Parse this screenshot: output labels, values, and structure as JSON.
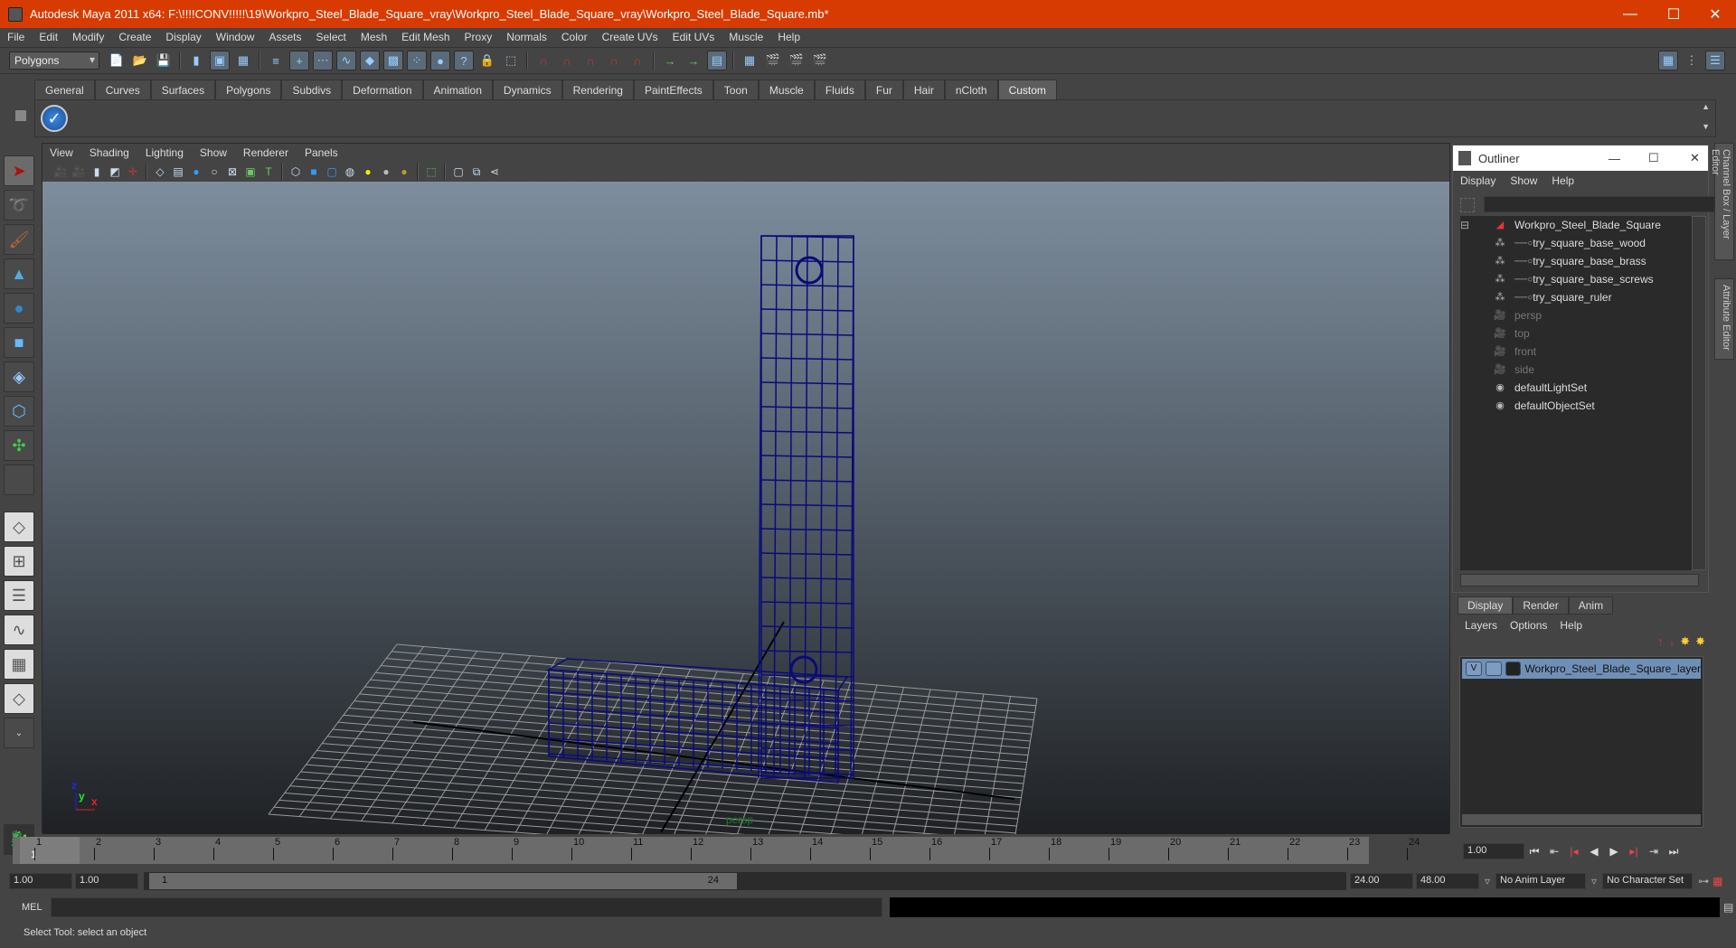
{
  "window": {
    "title": "Autodesk Maya 2011 x64: F:\\!!!!CONV!!!!!\\19\\Workpro_Steel_Blade_Square_vray\\Workpro_Steel_Blade_Square_vray\\Workpro_Steel_Blade_Square.mb*",
    "minimize": "—",
    "maximize": "☐",
    "close": "✕"
  },
  "menubar": [
    "File",
    "Edit",
    "Modify",
    "Create",
    "Display",
    "Window",
    "Assets",
    "Select",
    "Mesh",
    "Edit Mesh",
    "Proxy",
    "Normals",
    "Color",
    "Create UVs",
    "Edit UVs",
    "Muscle",
    "Help"
  ],
  "toolbar": {
    "mode": "Polygons"
  },
  "shelf": {
    "tabs": [
      "General",
      "Curves",
      "Surfaces",
      "Polygons",
      "Subdivs",
      "Deformation",
      "Animation",
      "Dynamics",
      "Rendering",
      "PaintEffects",
      "Toon",
      "Muscle",
      "Fluids",
      "Fur",
      "Hair",
      "nCloth",
      "Custom"
    ],
    "active": "Custom"
  },
  "viewport": {
    "menu": [
      "View",
      "Shading",
      "Lighting",
      "Show",
      "Renderer",
      "Panels"
    ],
    "camera_label": "persp",
    "axis": {
      "x": "x",
      "y": "y",
      "z": "z"
    },
    "wire_color": "#0a0a7a"
  },
  "outliner": {
    "title": "Outliner",
    "menu": [
      "Display",
      "Show",
      "Help"
    ],
    "items": [
      {
        "label": "Workpro_Steel_Blade_Square",
        "icon": "transform-icon",
        "indent": 0,
        "dim": false
      },
      {
        "label": "try_square_base_wood",
        "icon": "mesh-icon",
        "indent": 1,
        "dim": false
      },
      {
        "label": "try_square_base_brass",
        "icon": "mesh-icon",
        "indent": 1,
        "dim": false
      },
      {
        "label": "try_square_base_screws",
        "icon": "mesh-icon",
        "indent": 1,
        "dim": false
      },
      {
        "label": "try_square_ruler",
        "icon": "mesh-icon",
        "indent": 1,
        "dim": false
      },
      {
        "label": "persp",
        "icon": "camera-icon",
        "indent": 0,
        "dim": true
      },
      {
        "label": "top",
        "icon": "camera-icon",
        "indent": 0,
        "dim": true
      },
      {
        "label": "front",
        "icon": "camera-icon",
        "indent": 0,
        "dim": true
      },
      {
        "label": "side",
        "icon": "camera-icon",
        "indent": 0,
        "dim": true
      },
      {
        "label": "defaultLightSet",
        "icon": "set-icon",
        "indent": 0,
        "dim": false
      },
      {
        "label": "defaultObjectSet",
        "icon": "set-icon",
        "indent": 0,
        "dim": false
      }
    ]
  },
  "sidetabs": [
    "Channel Box / Layer Editor",
    "Attribute Editor"
  ],
  "layers": {
    "tabs": [
      "Display",
      "Render",
      "Anim"
    ],
    "active": "Display",
    "menu": [
      "Layers",
      "Options",
      "Help"
    ],
    "rows": [
      {
        "visible": "V",
        "name": "Workpro_Steel_Blade_Square_layer"
      }
    ]
  },
  "timeline": {
    "ticks": [
      "1",
      "2",
      "3",
      "4",
      "5",
      "6",
      "7",
      "8",
      "9",
      "10",
      "11",
      "12",
      "13",
      "14",
      "15",
      "16",
      "17",
      "18",
      "19",
      "20",
      "21",
      "22",
      "23",
      "24"
    ],
    "current": "1",
    "current_field": "1.00"
  },
  "range": {
    "start": "1.00",
    "anim_start": "1.00",
    "slider_start": "1",
    "slider_end": "24",
    "end": "24.00",
    "anim_end": "48.00",
    "anim_layer": "No Anim Layer",
    "char_set": "No Character Set"
  },
  "cmd": {
    "label": "MEL"
  },
  "status": {
    "text": "Select Tool: select an object"
  }
}
